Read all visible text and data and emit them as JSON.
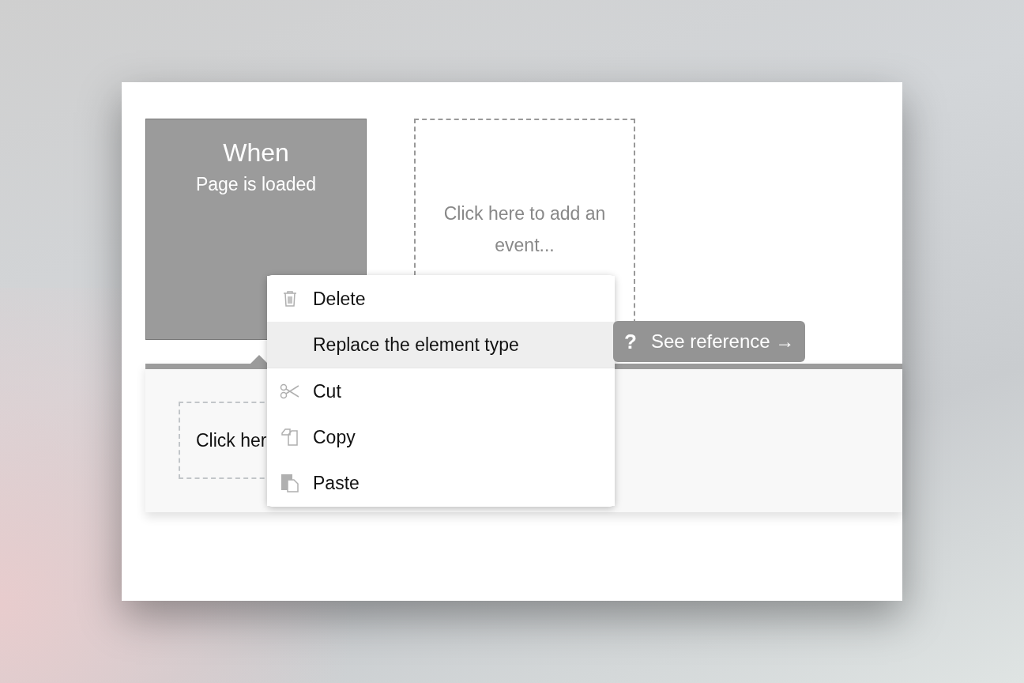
{
  "trigger": {
    "title": "When",
    "subtitle": "Page is loaded"
  },
  "add_event": {
    "text": "Click here to add an event..."
  },
  "actions_panel": {
    "placeholder_text": "Click her"
  },
  "context_menu": {
    "items": [
      {
        "label": "Delete",
        "selected": false
      },
      {
        "label": "Replace the element type",
        "selected": true
      },
      {
        "label": "Cut",
        "selected": false
      },
      {
        "label": "Copy",
        "selected": false
      },
      {
        "label": "Paste",
        "selected": false
      }
    ]
  },
  "reference_button": {
    "icon_text": "?",
    "label": "See reference →"
  }
}
